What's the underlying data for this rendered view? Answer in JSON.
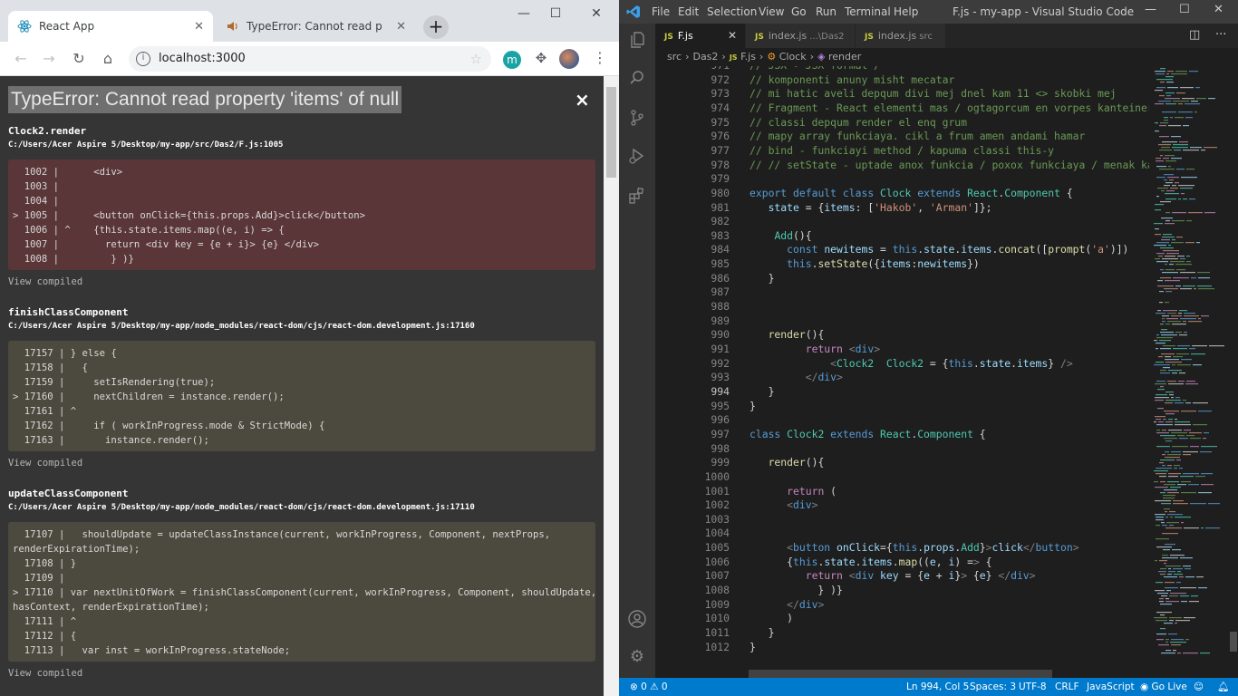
{
  "chrome": {
    "tabs": [
      {
        "title": "React App",
        "close": "✕"
      },
      {
        "title": "TypeError: Cannot read proper",
        "close": "✕"
      }
    ],
    "new_tab": "+",
    "address": "localhost:3000",
    "extension_letter": "m",
    "window": {
      "minimize": "—",
      "maximize": "☐",
      "close": "✕"
    }
  },
  "overlay": {
    "title": "TypeError: Cannot read property 'items' of null",
    "close": "×",
    "view_compiled": "View compiled",
    "frames": [
      {
        "name": "Clock2.render",
        "file": "C:/Users/Acer Aspire 5/Desktop/my-app/src/Das2/F.js:1005",
        "lines": [
          "  1002 |      <div>",
          "  1003 |",
          "  1004 |",
          "> 1005 |      <button onClick={this.props.Add}>click</button>",
          "  1006 | ^    {this.state.items.map((e, i) => {",
          "  1007 |        return <div key = {e + i}> {e} </div>",
          "  1008 |         } )}"
        ]
      },
      {
        "name": "finishClassComponent",
        "file": "C:/Users/Acer Aspire 5/Desktop/my-app/node_modules/react-dom/cjs/react-dom.development.js:17160",
        "lines": [
          "  17157 | } else {",
          "  17158 |   {",
          "  17159 |     setIsRendering(true);",
          "> 17160 |     nextChildren = instance.render();",
          "  17161 | ^",
          "  17162 |     if ( workInProgress.mode & StrictMode) {",
          "  17163 |       instance.render();"
        ]
      },
      {
        "name": "updateClassComponent",
        "file": "C:/Users/Acer Aspire 5/Desktop/my-app/node_modules/react-dom/cjs/react-dom.development.js:17110",
        "lines": [
          "  17107 |   shouldUpdate = updateClassInstance(current, workInProgress, Component, nextProps,",
          "renderExpirationTime);",
          "  17108 | }",
          "  17109 |",
          "> 17110 | var nextUnitOfWork = finishClassComponent(current, workInProgress, Component, shouldUpdate,",
          "hasContext, renderExpirationTime);",
          "  17111 | ^",
          "  17112 | {",
          "  17113 |   var inst = workInProgress.stateNode;"
        ]
      }
    ]
  },
  "vscode": {
    "menu": [
      "File",
      "Edit",
      "Selection",
      "View",
      "Go",
      "Run",
      "Terminal",
      "Help"
    ],
    "window_title": "F.js - my-app - Visual Studio Code",
    "tabs": [
      {
        "icon": "JS",
        "name": "F.js",
        "sub": "",
        "close": "✕"
      },
      {
        "icon": "JS",
        "name": "index.js",
        "sub": "...\\Das2",
        "close": ""
      },
      {
        "icon": "JS",
        "name": "index.js",
        "sub": "src",
        "close": ""
      }
    ],
    "breadcrumbs": [
      "src",
      "Das2",
      "F.js",
      "Clock",
      "render"
    ],
    "code_lines": [
      {
        "n": "971",
        "t": "// JSX - JSX format /"
      },
      {
        "n": "972",
        "t": "// komponenti anuny misht mecatar"
      },
      {
        "n": "973",
        "t": "// mi hatic aveli depqum divi mej dnel kam 11 <> skobki mej"
      },
      {
        "n": "974",
        "t": "// Fragment - React elementi mas / ogtagorcum en vorpes kanteiner vory tuyl"
      },
      {
        "n": "975",
        "t": "// classi depqum render el enq grum"
      },
      {
        "n": "976",
        "t": "// mapy array funkciaya. cikl a frum amen andami hamar"
      },
      {
        "n": "977",
        "t": "// bind - funkciayi method / kapuma classi this-y"
      },
      {
        "n": "978",
        "t": "// // setState - uptade anox funkcia / poxox funkciaya / menak karas poxes s"
      },
      {
        "n": "979",
        "t": ""
      },
      {
        "n": "980",
        "t": "export default class Clock extends React.Component {"
      },
      {
        "n": "981",
        "t": "   state = {items: ['Hakob', 'Arman']};"
      },
      {
        "n": "982",
        "t": ""
      },
      {
        "n": "983",
        "t": "    Add(){"
      },
      {
        "n": "984",
        "t": "      const newitems = this.state.items.concat([prompt('a')])"
      },
      {
        "n": "985",
        "t": "      this.setState({items:newitems})"
      },
      {
        "n": "986",
        "t": "   }"
      },
      {
        "n": "987",
        "t": ""
      },
      {
        "n": "988",
        "t": ""
      },
      {
        "n": "989",
        "t": ""
      },
      {
        "n": "990",
        "t": "   render(){"
      },
      {
        "n": "991",
        "t": "         return <div>"
      },
      {
        "n": "992",
        "t": "             <Clock2  Clock2 = {this.state.items} />"
      },
      {
        "n": "993",
        "t": "         </div>"
      },
      {
        "n": "994",
        "t": "   }"
      },
      {
        "n": "995",
        "t": "}"
      },
      {
        "n": "996",
        "t": ""
      },
      {
        "n": "997",
        "t": "class Clock2 extends React.Component {"
      },
      {
        "n": "998",
        "t": ""
      },
      {
        "n": "999",
        "t": "   render(){"
      },
      {
        "n": "1000",
        "t": ""
      },
      {
        "n": "1001",
        "t": "      return ("
      },
      {
        "n": "1002",
        "t": "      <div>"
      },
      {
        "n": "1003",
        "t": ""
      },
      {
        "n": "1004",
        "t": ""
      },
      {
        "n": "1005",
        "t": "      <button onClick={this.props.Add}>click</button>"
      },
      {
        "n": "1006",
        "t": "      {this.state.items.map((e, i) => {"
      },
      {
        "n": "1007",
        "t": "         return <div key = {e + i}> {e} </div>"
      },
      {
        "n": "1008",
        "t": "           } )}"
      },
      {
        "n": "1009",
        "t": "      </div>"
      },
      {
        "n": "1010",
        "t": "      )"
      },
      {
        "n": "1011",
        "t": "   }"
      },
      {
        "n": "1012",
        "t": "}"
      }
    ],
    "status": {
      "errors": "0",
      "warnings": "0",
      "position": "Ln 994, Col 5",
      "spaces": "Spaces: 3",
      "encoding": "UTF-8",
      "eol": "CRLF",
      "language": "JavaScript",
      "golive": "Go Live"
    }
  },
  "colors": {
    "accent": "#007acc",
    "error_box": "#5b3638",
    "stack_box": "#4c4a3e"
  }
}
